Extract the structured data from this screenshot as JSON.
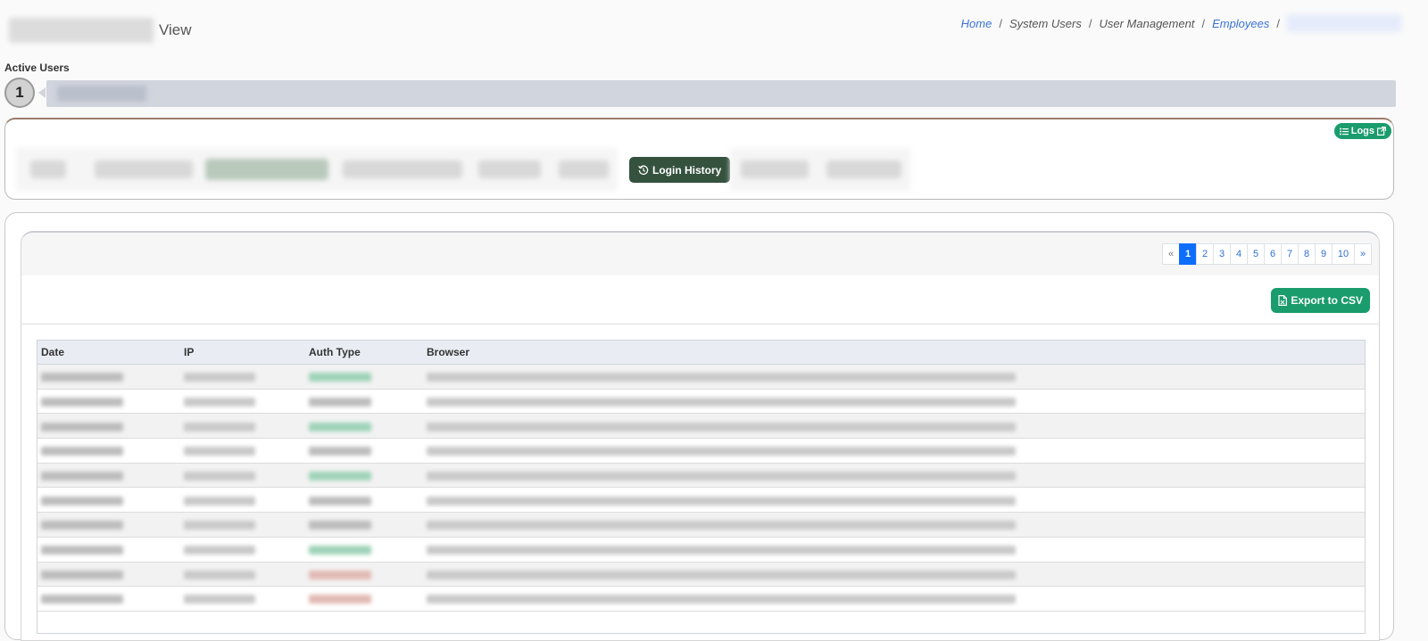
{
  "header": {
    "title_suffix": "View",
    "breadcrumb": {
      "home": "Home",
      "system_users": "System Users",
      "user_management": "User Management",
      "employees": "Employees",
      "separator": "/"
    }
  },
  "active_users": {
    "title": "Active Users",
    "count": "1"
  },
  "nav": {
    "logs_label": "Logs",
    "login_history_label": "Login History"
  },
  "pagination": {
    "prev": "«",
    "next": "»",
    "pages": [
      "1",
      "2",
      "3",
      "4",
      "5",
      "6",
      "7",
      "8",
      "9",
      "10"
    ],
    "active": "1"
  },
  "toolbar": {
    "export_label": "Export to CSV"
  },
  "table": {
    "columns": [
      "Date",
      "IP",
      "Auth Type",
      "Browser"
    ],
    "rows": [
      {
        "auth": "green"
      },
      {
        "auth": "gray"
      },
      {
        "auth": "green"
      },
      {
        "auth": "gray"
      },
      {
        "auth": "green"
      },
      {
        "auth": "gray"
      },
      {
        "auth": "gray"
      },
      {
        "auth": "green"
      },
      {
        "auth": "red"
      },
      {
        "auth": "red"
      }
    ]
  },
  "colors": {
    "accent_green": "#1a9c6d",
    "login_button": "#35523f",
    "pagination_active": "#0d6efd",
    "link": "#3b73d6"
  }
}
